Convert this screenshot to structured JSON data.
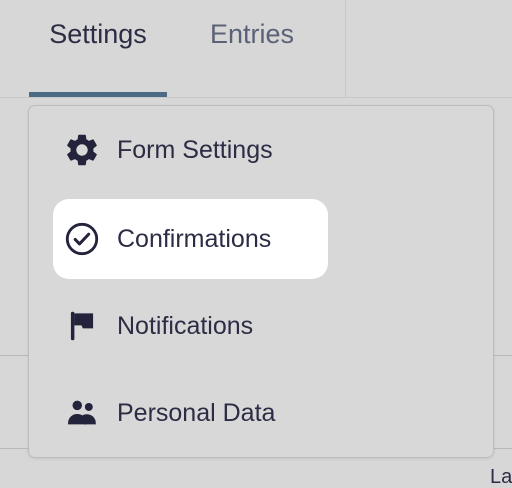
{
  "tabs": [
    {
      "label": "Settings",
      "active": true
    },
    {
      "label": "Entries",
      "active": false
    }
  ],
  "menu": {
    "items": [
      {
        "label": "Form Settings",
        "icon": "gear-icon",
        "active": false
      },
      {
        "label": "Confirmations",
        "icon": "check-circle-icon",
        "active": true
      },
      {
        "label": "Notifications",
        "icon": "flag-icon",
        "active": false
      },
      {
        "label": "Personal Data",
        "icon": "users-icon",
        "active": false
      }
    ]
  },
  "background": {
    "edge_text": "La"
  },
  "colors": {
    "accent": "#4d6b84",
    "text": "#2c2c45",
    "muted_text": "#5b6177",
    "active_item_bg": "#ffffff",
    "page_bg": "#d7d7d7"
  }
}
